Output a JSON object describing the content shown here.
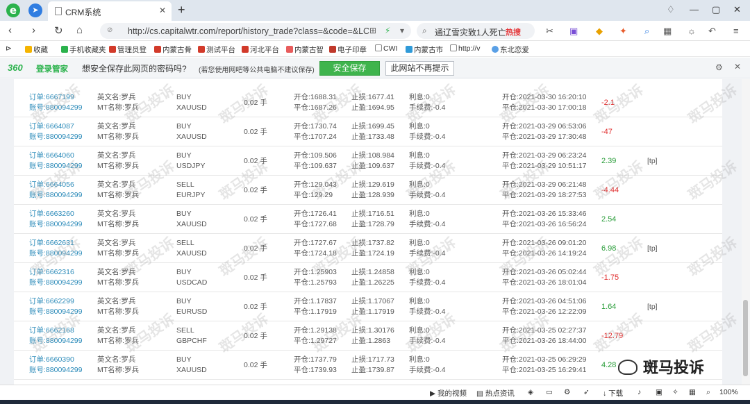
{
  "browser": {
    "tab_title": "CRM系统",
    "url": "http://cs.capitalwtr.com/report/history_trade?class=&code=&LC",
    "search_text": "通辽雪灾致1人死亡",
    "search_hot": "热搜",
    "zoom": "100%"
  },
  "bookmarks": [
    "收藏",
    "手机收藏夹",
    "管理员登",
    "内蒙古骨",
    "测试平台",
    "河北平台",
    "内蒙古智",
    "电子印章",
    "CWI",
    "内蒙古市",
    "http://v",
    "东北恋爱"
  ],
  "password_bar": {
    "brand_num": "360",
    "brand_text": "登录管家",
    "message": "想安全保存此网页的密码吗?",
    "hint": "(若您使用网吧等公共电脑不建议保存)",
    "save_button": "安全保存",
    "never_button": "此网站不再提示"
  },
  "labels": {
    "order": "订单:",
    "account": "账号:",
    "en_name": "英文名:",
    "mt_name": "MT名称:",
    "open": "开仓:",
    "close": "平仓:",
    "sl": "止损:",
    "tp": "止盈:",
    "interest": "利息:",
    "fee": "手续费:"
  },
  "trades": [
    {
      "order": "6667199",
      "account": "880094299",
      "en_name": "罗兵",
      "mt_name": "罗兵",
      "dir": "BUY",
      "symbol": "XAUUSD",
      "lots": "0.02 手",
      "open_price": "1688.31",
      "close_price": "1687.26",
      "sl": "1677.41",
      "tp": "1694.95",
      "interest": "0",
      "fee": "-0.4",
      "open_time": "2021-03-30 16:20:10",
      "close_time": "2021-03-30 17:00:18",
      "profit": "-2.1",
      "tag": ""
    },
    {
      "order": "6664087",
      "account": "880094299",
      "en_name": "罗兵",
      "mt_name": "罗兵",
      "dir": "BUY",
      "symbol": "XAUUSD",
      "lots": "0.02 手",
      "open_price": "1730.74",
      "close_price": "1707.24",
      "sl": "1699.45",
      "tp": "1733.48",
      "interest": "0",
      "fee": "-0.4",
      "open_time": "2021-03-29 06:53:06",
      "close_time": "2021-03-29 17:30:48",
      "profit": "-47",
      "tag": ""
    },
    {
      "order": "6664060",
      "account": "880094299",
      "en_name": "罗兵",
      "mt_name": "罗兵",
      "dir": "BUY",
      "symbol": "USDJPY",
      "lots": "0.02 手",
      "open_price": "109.506",
      "close_price": "109.637",
      "sl": "108.984",
      "tp": "109.637",
      "interest": "0",
      "fee": "-0.4",
      "open_time": "2021-03-29 06:23:24",
      "close_time": "2021-03-29 10:51:17",
      "profit": "2.39",
      "tag": "[tp]"
    },
    {
      "order": "6664056",
      "account": "880094299",
      "en_name": "罗兵",
      "mt_name": "罗兵",
      "dir": "SELL",
      "symbol": "EURJPY",
      "lots": "0.02 手",
      "open_price": "129.043",
      "close_price": "129.29",
      "sl": "129.619",
      "tp": "128.939",
      "interest": "0",
      "fee": "-0.4",
      "open_time": "2021-03-29 06:21:48",
      "close_time": "2021-03-29 18:27:53",
      "profit": "-4.44",
      "tag": ""
    },
    {
      "order": "6663260",
      "account": "880094299",
      "en_name": "罗兵",
      "mt_name": "罗兵",
      "dir": "BUY",
      "symbol": "XAUUSD",
      "lots": "0.02 手",
      "open_price": "1726.41",
      "close_price": "1727.68",
      "sl": "1716.51",
      "tp": "1728.79",
      "interest": "0",
      "fee": "-0.4",
      "open_time": "2021-03-26 15:33:46",
      "close_time": "2021-03-26 16:56:24",
      "profit": "2.54",
      "tag": ""
    },
    {
      "order": "6662631",
      "account": "880094299",
      "en_name": "罗兵",
      "mt_name": "罗兵",
      "dir": "SELL",
      "symbol": "XAUUSD",
      "lots": "0.02 手",
      "open_price": "1727.67",
      "close_price": "1724.18",
      "sl": "1737.82",
      "tp": "1724.19",
      "interest": "0",
      "fee": "-0.4",
      "open_time": "2021-03-26 09:01:20",
      "close_time": "2021-03-26 14:19:24",
      "profit": "6.98",
      "tag": "[tp]"
    },
    {
      "order": "6662316",
      "account": "880094299",
      "en_name": "罗兵",
      "mt_name": "罗兵",
      "dir": "BUY",
      "symbol": "USDCAD",
      "lots": "0.02 手",
      "open_price": "1.25903",
      "close_price": "1.25793",
      "sl": "1.24858",
      "tp": "1.26225",
      "interest": "0",
      "fee": "-0.4",
      "open_time": "2021-03-26 05:02:44",
      "close_time": "2021-03-26 18:01:04",
      "profit": "-1.75",
      "tag": ""
    },
    {
      "order": "6662299",
      "account": "880094299",
      "en_name": "罗兵",
      "mt_name": "罗兵",
      "dir": "BUY",
      "symbol": "EURUSD",
      "lots": "0.02 手",
      "open_price": "1.17837",
      "close_price": "1.17919",
      "sl": "1.17067",
      "tp": "1.17919",
      "interest": "0",
      "fee": "-0.4",
      "open_time": "2021-03-26 04:51:06",
      "close_time": "2021-03-26 12:22:09",
      "profit": "1.64",
      "tag": "[tp]"
    },
    {
      "order": "6662168",
      "account": "880094299",
      "en_name": "罗兵",
      "mt_name": "罗兵",
      "dir": "SELL",
      "symbol": "GBPCHF",
      "lots": "0.02 手",
      "open_price": "1.29138",
      "close_price": "1.29727",
      "sl": "1.30176",
      "tp": "1.2863",
      "interest": "0",
      "fee": "-0.4",
      "open_time": "2021-03-25 02:27:37",
      "close_time": "2021-03-26 18:44:00",
      "profit": "-12.79",
      "tag": ""
    },
    {
      "order": "6660390",
      "account": "880094299",
      "en_name": "罗兵",
      "mt_name": "罗兵",
      "dir": "BUY",
      "symbol": "XAUUSD",
      "lots": "0.02 手",
      "open_price": "1737.79",
      "close_price": "1739.93",
      "sl": "1717.73",
      "tp": "1739.87",
      "interest": "0",
      "fee": "-0.4",
      "open_time": "2021-03-25 06:29:29",
      "close_time": "2021-03-25 16:29:41",
      "profit": "4.28",
      "tag": "[tp]"
    }
  ],
  "statusbar": {
    "video": "我的视频",
    "news": "热点资讯",
    "download": "下载"
  },
  "watermark": {
    "tag": "斑马投诉"
  },
  "colors": {
    "positive": "#2a9d3a",
    "negative": "#e02d2d",
    "link": "#2a8ab9",
    "brand_green": "#2bb24c"
  }
}
